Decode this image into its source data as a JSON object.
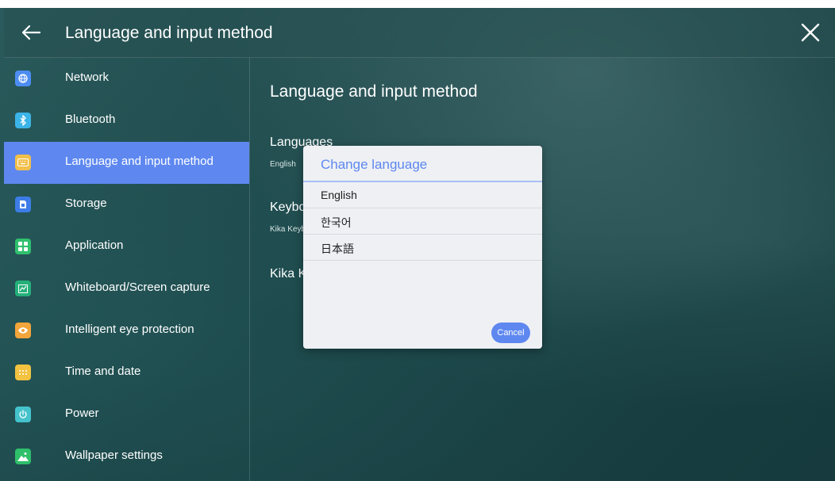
{
  "header": {
    "title": "Language and input method",
    "back_icon": "arrow-left-icon",
    "close_icon": "close-icon"
  },
  "sidebar": {
    "items": [
      {
        "label": "Network",
        "icon": "globe-icon",
        "color": "#4d8df2"
      },
      {
        "label": "Bluetooth",
        "icon": "bluetooth-icon",
        "color": "#3bb4e8"
      },
      {
        "label": "Language and input method",
        "icon": "keyboard-icon",
        "color": "#f2bf4a",
        "selected": true
      },
      {
        "label": "Storage",
        "icon": "storage-icon",
        "color": "#3d7de8"
      },
      {
        "label": "Application",
        "icon": "apps-icon",
        "color": "#2fc06d"
      },
      {
        "label": "Whiteboard/Screen capture",
        "icon": "screenshot-icon",
        "color": "#25b07a"
      },
      {
        "label": "Intelligent eye protection",
        "icon": "eye-icon",
        "color": "#f2a53a"
      },
      {
        "label": "Time and date",
        "icon": "calendar-icon",
        "color": "#f2c240"
      },
      {
        "label": "Power",
        "icon": "power-icon",
        "color": "#45c3cc"
      },
      {
        "label": "Wallpaper settings",
        "icon": "image-icon",
        "color": "#2fbf6a"
      }
    ]
  },
  "content": {
    "title": "Language and input method",
    "languages": {
      "title": "Languages",
      "value": "English"
    },
    "keyboard": {
      "title": "Keyboard",
      "value": "Kika Keyboard"
    },
    "kika": {
      "title": "Kika Keyboard"
    }
  },
  "dialog": {
    "title": "Change language",
    "options": [
      "English",
      "한국어",
      "日本語"
    ],
    "cancel_label": "Cancel"
  },
  "colors": {
    "accent": "#5e88f0",
    "background": "#1d4a4c"
  }
}
